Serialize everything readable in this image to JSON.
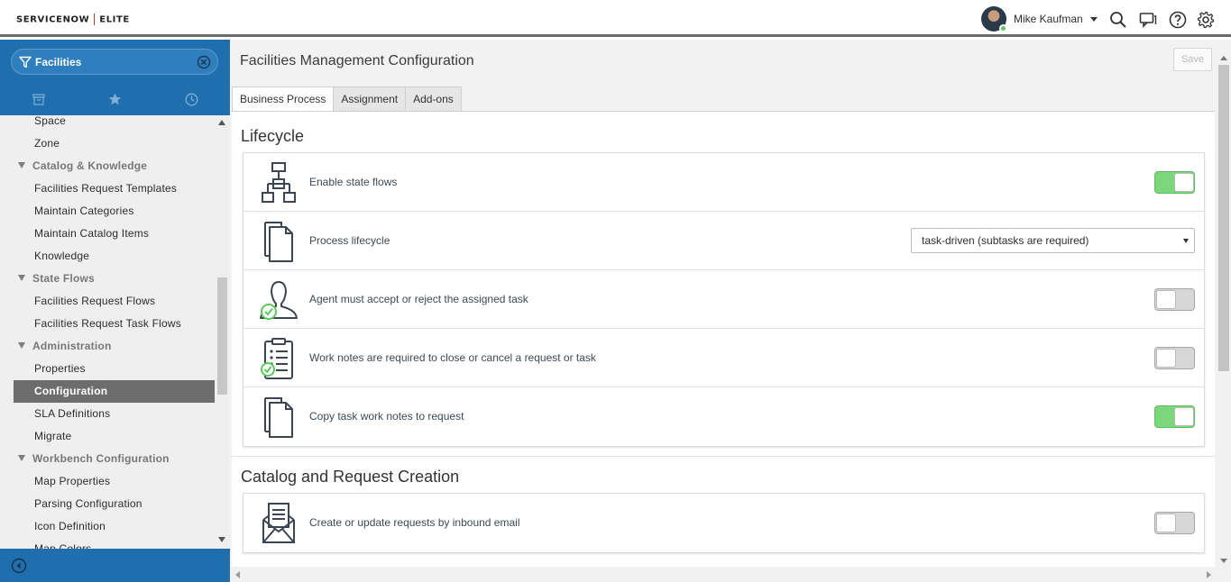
{
  "header": {
    "logo_left": "SERVICENOW",
    "logo_right": "ELITE",
    "user_name": "Mike Kaufman",
    "icons": [
      "search-icon",
      "chat-icon",
      "help-icon",
      "gear-icon"
    ]
  },
  "sidebar": {
    "filter_value": "Facilities",
    "tab_icons": [
      "archive-icon",
      "star-icon",
      "clock-icon"
    ],
    "items": [
      {
        "type": "item",
        "label": "Space"
      },
      {
        "type": "item",
        "label": "Zone"
      },
      {
        "type": "section",
        "label": "Catalog & Knowledge"
      },
      {
        "type": "item",
        "label": "Facilities Request Templates"
      },
      {
        "type": "item",
        "label": "Maintain Categories"
      },
      {
        "type": "item",
        "label": "Maintain Catalog Items"
      },
      {
        "type": "item",
        "label": "Knowledge"
      },
      {
        "type": "section",
        "label": "State Flows"
      },
      {
        "type": "item",
        "label": "Facilities Request Flows"
      },
      {
        "type": "item",
        "label": "Facilities Request Task Flows"
      },
      {
        "type": "section",
        "label": "Administration"
      },
      {
        "type": "item",
        "label": "Properties"
      },
      {
        "type": "item",
        "label": "Configuration",
        "active": true
      },
      {
        "type": "item",
        "label": "SLA Definitions"
      },
      {
        "type": "item",
        "label": "Migrate"
      },
      {
        "type": "section",
        "label": "Workbench Configuration"
      },
      {
        "type": "item",
        "label": "Map Properties"
      },
      {
        "type": "item",
        "label": "Parsing Configuration"
      },
      {
        "type": "item",
        "label": "Icon Definition"
      },
      {
        "type": "item",
        "label": "Map Colors"
      }
    ]
  },
  "main": {
    "title": "Facilities Management Configuration",
    "save_label": "Save",
    "tabs": [
      {
        "label": "Business Process",
        "active": true
      },
      {
        "label": "Assignment"
      },
      {
        "label": "Add-ons"
      }
    ],
    "lifecycle": {
      "title": "Lifecycle",
      "rows": [
        {
          "icon": "state-flow-icon",
          "label": "Enable state flows",
          "control": "toggle",
          "on": true
        },
        {
          "icon": "documents-icon",
          "label": "Process lifecycle",
          "control": "select",
          "value": "task-driven (subtasks are required)"
        },
        {
          "icon": "user-check-icon",
          "label": "Agent must accept or reject the assigned task",
          "control": "toggle",
          "on": false
        },
        {
          "icon": "checklist-icon",
          "label": "Work notes are required to close or cancel a request or task",
          "control": "toggle",
          "on": false
        },
        {
          "icon": "documents-icon",
          "label": "Copy task work notes to request",
          "control": "toggle",
          "on": true
        }
      ]
    },
    "catalog": {
      "title": "Catalog and Request Creation",
      "rows": [
        {
          "icon": "email-icon",
          "label": "Create or update requests by inbound email",
          "control": "toggle",
          "on": false
        }
      ]
    }
  },
  "colors": {
    "nav_blue": "#1f6fae",
    "toggle_on": "#7cd67c",
    "active_item": "#6d6d6d"
  }
}
